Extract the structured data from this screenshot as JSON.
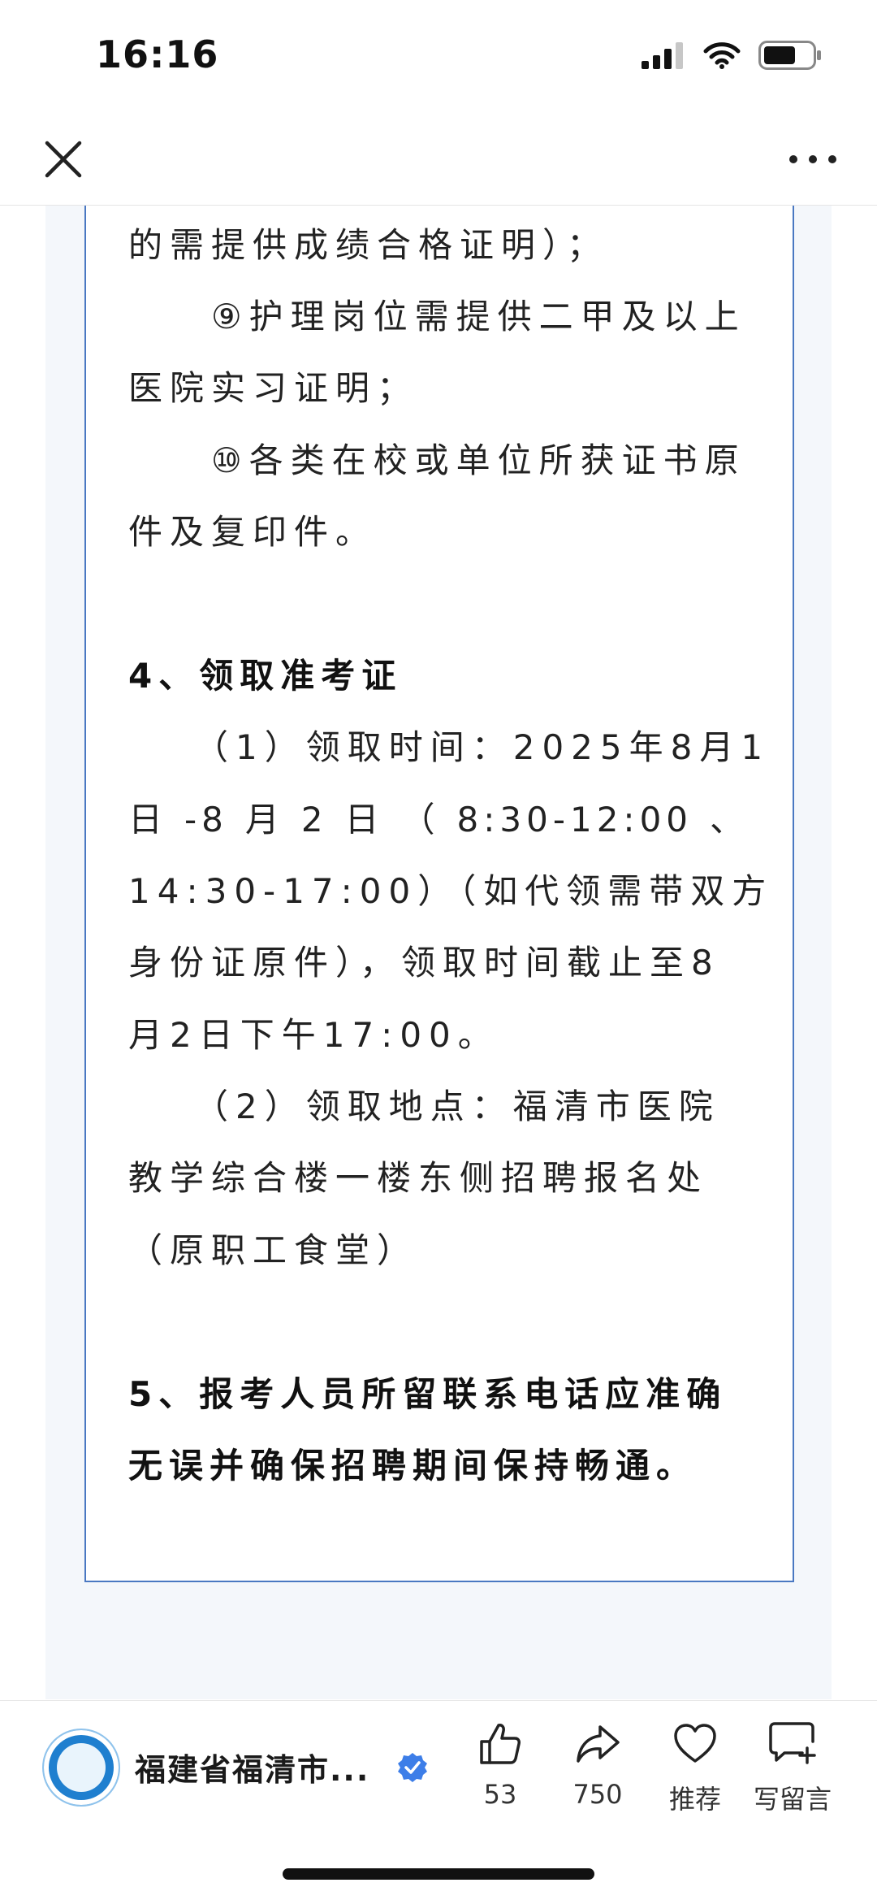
{
  "status_bar": {
    "time": "16:16"
  },
  "article": {
    "lines": [
      "的需提供成绩合格证明）；",
      "　　⑨护理岗位需提供二甲及以上",
      "医院实习证明；",
      "　　⑩各类在校或单位所获证书原",
      "件及复印件。",
      "4、领取准考证",
      "　　（1）领取时间：2025年8月1",
      "日-8月2日（8:30-12:00、",
      "14:30-17:00）（如代领需带双方",
      "身份证原件），领取时间截止至8",
      "月2日下午17:00。",
      "　　（2）领取地点：福清市医院",
      "教学综合楼一楼东侧招聘报名处",
      "（原职工食堂）",
      "5、报考人员所留联系电话应准确",
      "无误并确保招聘期间保持畅通。"
    ]
  },
  "bottom_bar": {
    "account_name": "福建省福清市...",
    "like_count": "53",
    "share_count": "750",
    "recommend_label": "推荐",
    "comment_label": "写留言"
  },
  "colors": {
    "accent": "#4a78c2",
    "verified": "#3d7ee8",
    "page_bg": "#f4f7fb"
  }
}
